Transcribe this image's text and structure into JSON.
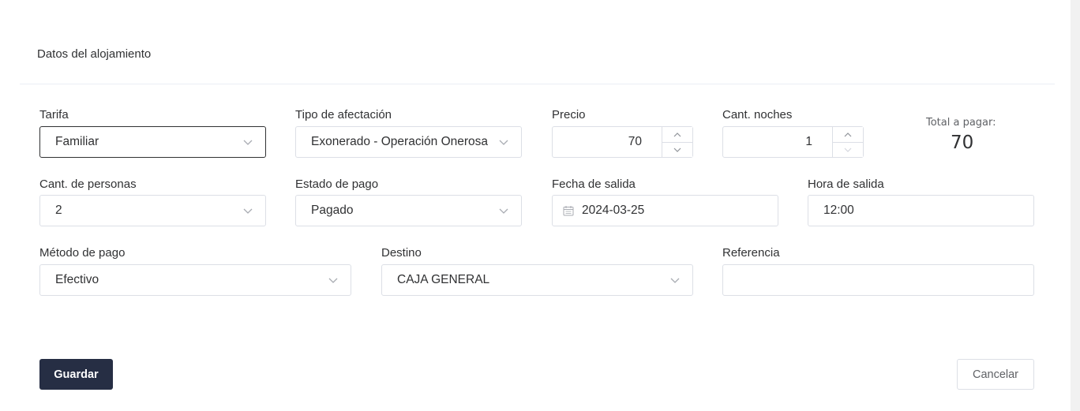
{
  "card": {
    "title": "Datos del alojamiento"
  },
  "fields": {
    "tarifa": {
      "label": "Tarifa",
      "value": "Familiar"
    },
    "tipo_afectacion": {
      "label": "Tipo de afectación",
      "value": "Exonerado - Operación Onerosa"
    },
    "precio": {
      "label": "Precio",
      "value": "70"
    },
    "cant_noches": {
      "label": "Cant. noches",
      "value": "1"
    },
    "cant_personas": {
      "label": "Cant. de personas",
      "value": "2"
    },
    "estado_pago": {
      "label": "Estado de pago",
      "value": "Pagado"
    },
    "fecha_salida": {
      "label": "Fecha de salida",
      "value": "2024-03-25"
    },
    "hora_salida": {
      "label": "Hora de salida",
      "value": "12:00"
    },
    "metodo_pago": {
      "label": "Método de pago",
      "value": "Efectivo"
    },
    "destino": {
      "label": "Destino",
      "value": "CAJA GENERAL"
    },
    "referencia": {
      "label": "Referencia",
      "value": ""
    }
  },
  "total": {
    "label": "Total a pagar:",
    "value": "70"
  },
  "actions": {
    "save_label": "Guardar",
    "cancel_label": "Cancelar"
  },
  "icons": {
    "select": "chevron-down-icon",
    "spin_up": "chevron-up-icon",
    "spin_down": "chevron-down-icon",
    "date": "calendar-icon"
  },
  "colors": {
    "primary_button": "#262e44",
    "border": "#dcdfe6",
    "active_border": "#303133",
    "text": "#303133"
  }
}
